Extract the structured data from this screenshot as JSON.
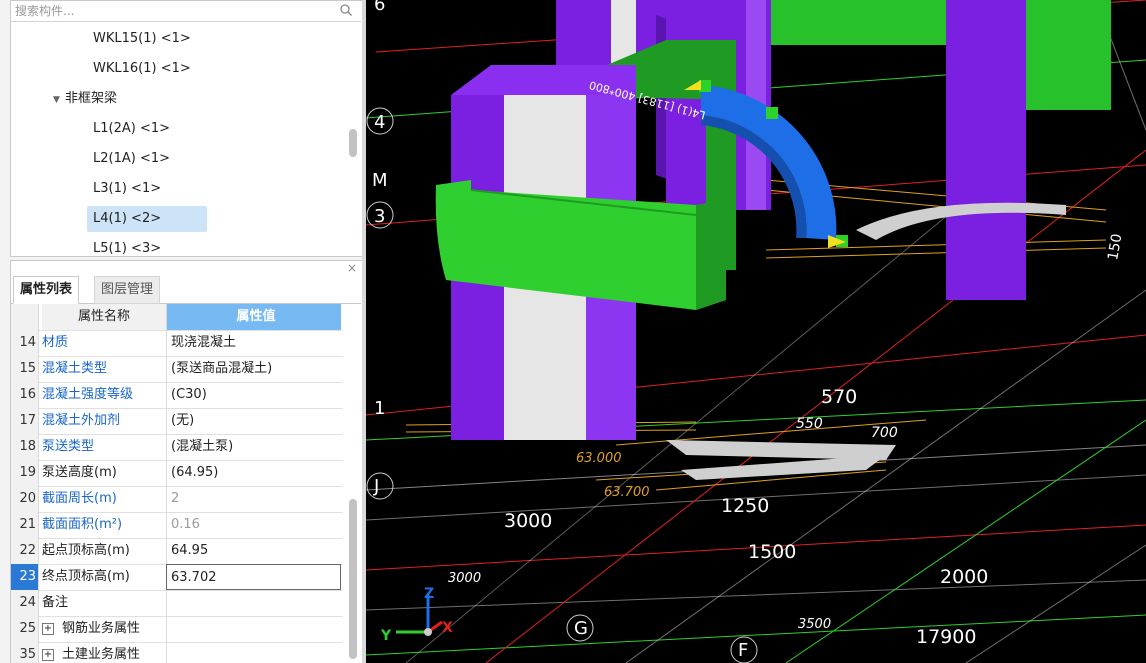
{
  "tree": {
    "search_placeholder": "搜索构件...",
    "items": [
      {
        "label": "WKL15(1) <1>"
      },
      {
        "label": "WKL16(1) <1>"
      },
      {
        "label": "L1(2A) <1>"
      },
      {
        "label": "L2(1A) <1>"
      },
      {
        "label": "L3(1) <1>"
      },
      {
        "label": "L4(1) <2>",
        "selected": true
      },
      {
        "label": "L5(1) <3>"
      }
    ],
    "group_label": "非框架梁"
  },
  "props": {
    "close": "×",
    "tabs": [
      "属性列表",
      "图层管理"
    ],
    "header": {
      "name": "属性名称",
      "value": "属性值"
    },
    "rows": [
      {
        "num": "14",
        "name": "材质",
        "value": "现浇混凝土"
      },
      {
        "num": "15",
        "name": "混凝土类型",
        "value": "(泵送商品混凝土)"
      },
      {
        "num": "16",
        "name": "混凝土强度等级",
        "value": "(C30)"
      },
      {
        "num": "17",
        "name": "混凝土外加剂",
        "value": "(无)"
      },
      {
        "num": "18",
        "name": "泵送类型",
        "value": "(混凝土泵)"
      },
      {
        "num": "19",
        "name": "泵送高度(m)",
        "value": "(64.95)"
      },
      {
        "num": "20",
        "name": "截面周长(m)",
        "value": "2"
      },
      {
        "num": "21",
        "name": "截面面积(m²)",
        "value": "0.16"
      },
      {
        "num": "22",
        "name": "起点顶标高(m)",
        "value": "64.95"
      },
      {
        "num": "23",
        "name": "终点顶标高(m)",
        "value": "63.702"
      },
      {
        "num": "24",
        "name": "备注",
        "value": ""
      },
      {
        "num": "25",
        "name": "钢筋业务属性",
        "value": ""
      },
      {
        "num": "35",
        "name": "土建业务属性",
        "value": ""
      }
    ]
  },
  "viewport": {
    "axis_labels": [
      "6",
      "4",
      "M",
      "3",
      "1",
      "J",
      "G",
      "F"
    ],
    "dimensions": [
      "570",
      "550",
      "700",
      "1250",
      "3000",
      "1500",
      "2000",
      "17900",
      "3000",
      "3500",
      "63.000",
      "63.700",
      "150"
    ],
    "beam_text": "L4(1) [1183] 400*800",
    "coord_axes": {
      "x": "X",
      "y": "Y",
      "z": "Z"
    }
  },
  "colors": {
    "selection_blue": "#2a7ad5",
    "header_blue": "#76b9f3",
    "column_purple": "#7b1fe0",
    "beam_green": "#27c22b",
    "arc_beam_blue": "#1e6ee8",
    "grid_red": "#e02020",
    "grid_green": "#2fcf2f",
    "dim_orange": "#e0a020"
  }
}
